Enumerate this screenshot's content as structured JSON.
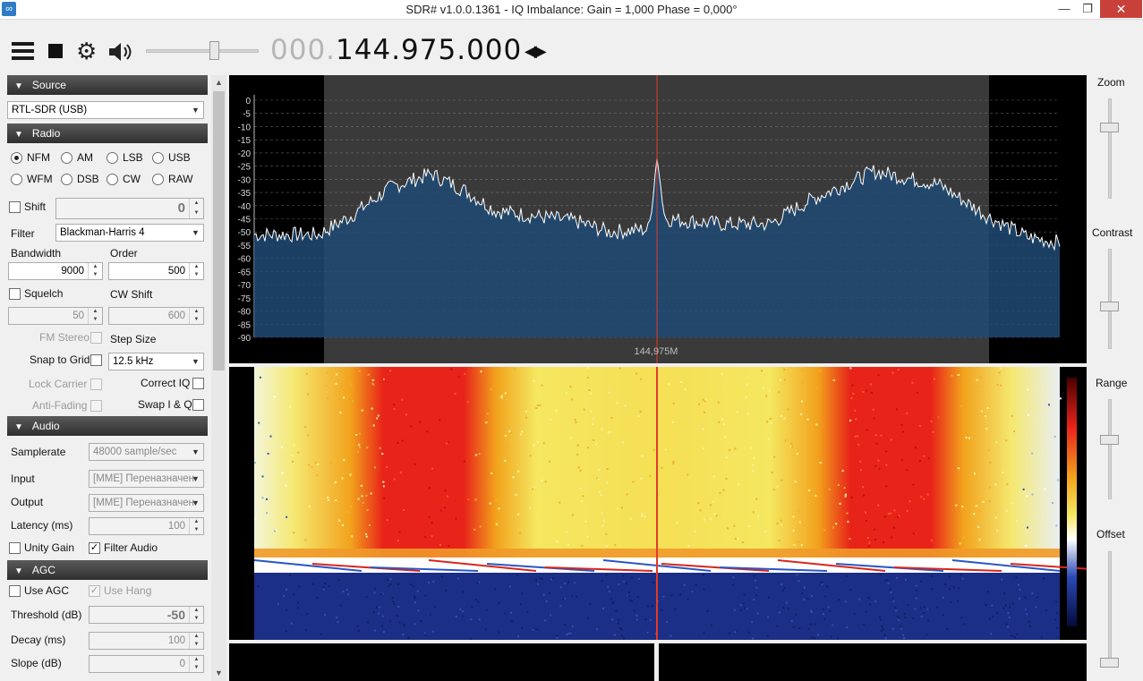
{
  "window": {
    "title": "SDR# v1.0.0.1361 - IQ Imbalance: Gain = 1,000 Phase = 0,000°",
    "minimize": "—",
    "maximize": "❐",
    "close": "✕"
  },
  "toolbar": {
    "frequency_prefix": "000.",
    "frequency_main": "144.975.000",
    "volume_level": 0.62,
    "tune_arrows": "◀▶"
  },
  "source": {
    "header": "Source",
    "device": "RTL-SDR (USB)"
  },
  "radio": {
    "header": "Radio",
    "modes": [
      {
        "label": "NFM",
        "selected": true
      },
      {
        "label": "AM",
        "selected": false
      },
      {
        "label": "LSB",
        "selected": false
      },
      {
        "label": "USB",
        "selected": false
      },
      {
        "label": "WFM",
        "selected": false
      },
      {
        "label": "DSB",
        "selected": false
      },
      {
        "label": "CW",
        "selected": false
      },
      {
        "label": "RAW",
        "selected": false
      }
    ],
    "shift_label": "Shift",
    "shift_value": "0",
    "filter_label": "Filter",
    "filter_value": "Blackman-Harris 4",
    "bandwidth_label": "Bandwidth",
    "bandwidth_value": "9000",
    "order_label": "Order",
    "order_value": "500",
    "squelch_label": "Squelch",
    "squelch_value": "50",
    "cwshift_label": "CW Shift",
    "cwshift_value": "600",
    "fmstereo_label": "FM Stereo",
    "stepsize_label": "Step Size",
    "snap_label": "Snap to Grid",
    "stepsize_value": "12.5 kHz",
    "lockcarrier_label": "Lock Carrier",
    "correctiq_label": "Correct IQ",
    "antifading_label": "Anti-Fading",
    "swapiq_label": "Swap I & Q"
  },
  "audio": {
    "header": "Audio",
    "samplerate_label": "Samplerate",
    "samplerate_value": "48000 sample/sec",
    "input_label": "Input",
    "input_value": "[MME] Переназначен",
    "output_label": "Output",
    "output_value": "[MME] Переназначен",
    "latency_label": "Latency (ms)",
    "latency_value": "100",
    "unitygain_label": "Unity Gain",
    "filteraudio_label": "Filter Audio"
  },
  "agc": {
    "header": "AGC",
    "useagc_label": "Use AGC",
    "usehang_label": "Use Hang",
    "threshold_label": "Threshold (dB)",
    "threshold_value": "-50",
    "decay_label": "Decay (ms)",
    "decay_value": "100",
    "slope_label": "Slope (dB)",
    "slope_value": "0"
  },
  "spectrum": {
    "y_ticks": [
      "0",
      "-5",
      "-10",
      "-15",
      "-20",
      "-25",
      "-30",
      "-35",
      "-40",
      "-45",
      "-50",
      "-55",
      "-60",
      "-65",
      "-70",
      "-75",
      "-80",
      "-85",
      "-90"
    ],
    "center_label": "144,975M",
    "trace_shape": [
      {
        "pos": 0.0,
        "db": -51
      },
      {
        "pos": 0.08,
        "db": -51
      },
      {
        "pos": 0.12,
        "db": -44
      },
      {
        "pos": 0.17,
        "db": -33
      },
      {
        "pos": 0.22,
        "db": -28
      },
      {
        "pos": 0.26,
        "db": -34
      },
      {
        "pos": 0.3,
        "db": -42
      },
      {
        "pos": 0.4,
        "db": -46
      },
      {
        "pos": 0.44,
        "db": -50
      },
      {
        "pos": 0.49,
        "db": -49
      },
      {
        "pos": 0.5,
        "db": -22
      },
      {
        "pos": 0.51,
        "db": -45
      },
      {
        "pos": 0.58,
        "db": -47
      },
      {
        "pos": 0.64,
        "db": -47
      },
      {
        "pos": 0.69,
        "db": -38
      },
      {
        "pos": 0.77,
        "db": -27
      },
      {
        "pos": 0.85,
        "db": -32
      },
      {
        "pos": 0.91,
        "db": -44
      },
      {
        "pos": 0.96,
        "db": -52
      },
      {
        "pos": 1.0,
        "db": -54
      }
    ],
    "colors": {
      "fill": "#1f4a73",
      "band": "#3a3a3a",
      "trace": "#ffffff",
      "marker": "#e23a2a"
    }
  },
  "waterfall": {
    "colors": {
      "hot": "#e8231a",
      "warm": "#f2a21c",
      "yellow": "#f5e760",
      "cold": "#1b2f86"
    }
  },
  "sliders": {
    "zoom_label": "Zoom",
    "contrast_label": "Contrast",
    "range_label": "Range",
    "offset_label": "Offset",
    "zoom_level": 0.27,
    "contrast_level": 0.58,
    "range_level": 0.4,
    "offset_level": 0.0
  }
}
